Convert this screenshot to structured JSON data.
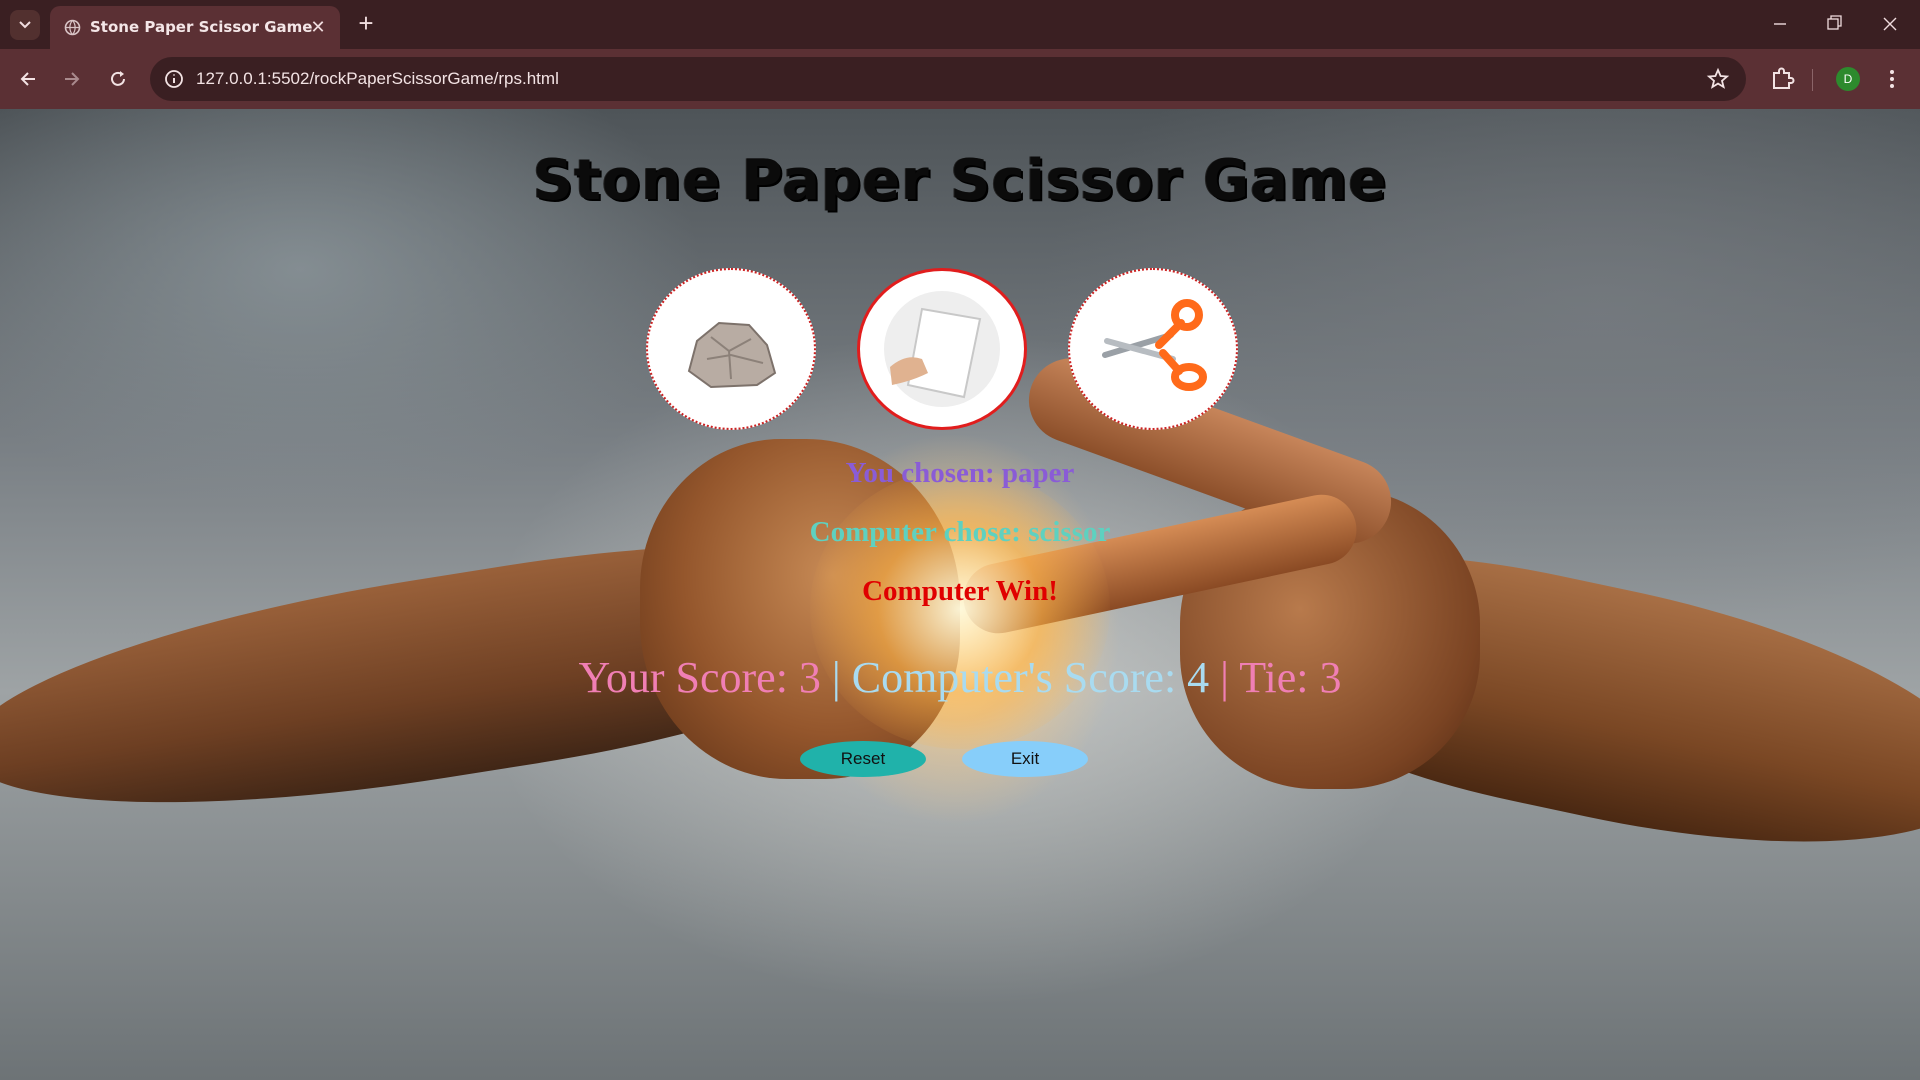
{
  "browser": {
    "tab_title": "Stone Paper Scissor Game",
    "url": "127.0.0.1:5502/rockPaperScissorGame/rps.html",
    "profile_initial": "D"
  },
  "game": {
    "title": "Stone Paper Scissor Game",
    "choices": [
      {
        "id": "stone",
        "icon": "rock-image",
        "selected": false
      },
      {
        "id": "paper",
        "icon": "paper-image",
        "selected": true
      },
      {
        "id": "scissor",
        "icon": "scissor-image",
        "selected": false
      }
    ],
    "user_choice_text": "You chosen: paper",
    "computer_choice_text": "Computer chose: scissor",
    "result_text": "Computer Win!",
    "score_user": "Your Score: 3",
    "score_separator_1": " | ",
    "score_computer": "Computer's Score: 4",
    "score_separator_2": " | ",
    "score_tie": "Tie: 3",
    "reset_label": "Reset",
    "exit_label": "Exit"
  },
  "colors": {
    "user_choice": "#8a5cd6",
    "computer_choice": "#5ed1c0",
    "result": "#e00000",
    "reset_button": "#20b2aa",
    "exit_button": "#87cefa"
  }
}
